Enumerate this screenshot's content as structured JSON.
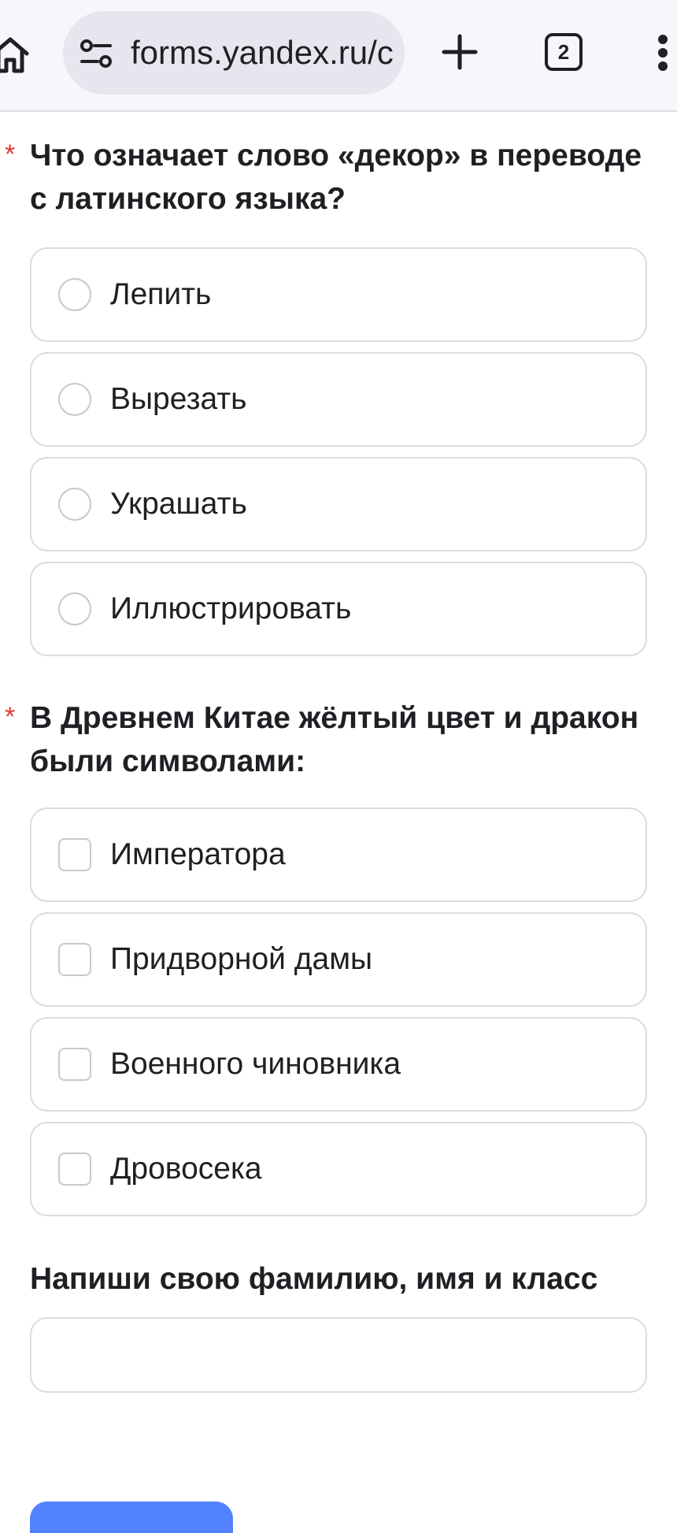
{
  "browser": {
    "url": "forms.yandex.ru/c",
    "tab_count": "2",
    "icons": {
      "home": "home-icon",
      "site_settings": "tune-icon",
      "new_tab": "plus-icon",
      "menu": "more-vert-icon"
    }
  },
  "form": {
    "required_mark": "*",
    "questions": [
      {
        "title": "Что означает слово «декор» в переводе с латинского языка?",
        "required": true,
        "type": "radio",
        "options": [
          {
            "label": "Лепить",
            "selected": false
          },
          {
            "label": "Вырезать",
            "selected": false
          },
          {
            "label": "Украшать",
            "selected": false
          },
          {
            "label": "Иллюстрировать",
            "selected": false
          }
        ]
      },
      {
        "title": "В Древнем Китае жёлтый цвет и дракон были символами:",
        "required": true,
        "type": "checkbox",
        "options": [
          {
            "label": "Императора",
            "selected": false
          },
          {
            "label": "Придворной дамы",
            "selected": false
          },
          {
            "label": "Военного чиновника",
            "selected": false
          },
          {
            "label": "Дровосека",
            "selected": false
          }
        ]
      },
      {
        "title": "Напиши свою фамилию, имя и класс",
        "required": false,
        "type": "text",
        "value": ""
      }
    ],
    "colors": {
      "required_star": "#e0393a",
      "submit_button": "#5282ff",
      "border": "#dcdbe0"
    }
  }
}
